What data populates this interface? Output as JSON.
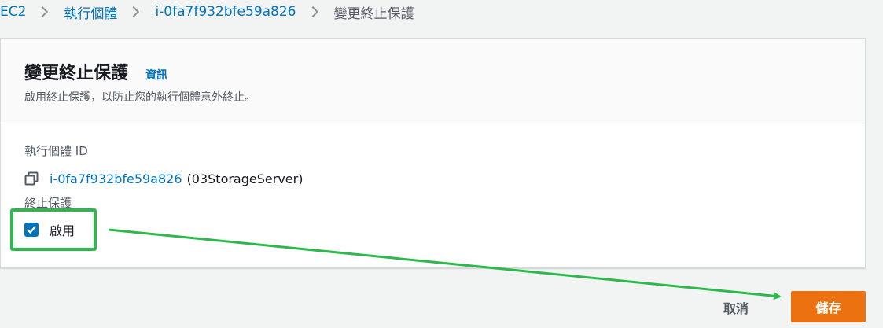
{
  "breadcrumb": {
    "items": [
      {
        "label": "EC2"
      },
      {
        "label": "執行個體"
      },
      {
        "label": "i-0fa7f932bfe59a826"
      },
      {
        "label": "變更終止保護"
      }
    ]
  },
  "panel": {
    "title": "變更終止保護",
    "info_link": "資訊",
    "description": "啟用終止保護，以防止您的執行個體意外終止。",
    "instance_id_label": "執行個體 ID",
    "instance_id": "i-0fa7f932bfe59a826",
    "instance_name": "(03StorageServer)",
    "protection_label": "終止保護",
    "enable_checkbox": {
      "label": "啟用",
      "checked": true
    }
  },
  "actions": {
    "cancel_label": "取消",
    "save_label": "儲存"
  },
  "colors": {
    "link": "#0073bb",
    "primary_button": "#ec7211",
    "checkbox": "#0073bb",
    "annotation": "#2db84b"
  },
  "icons": {
    "breadcrumb_separator": "chevron-right-icon",
    "copy": "copy-icon",
    "checkmark": "checkmark-icon"
  }
}
